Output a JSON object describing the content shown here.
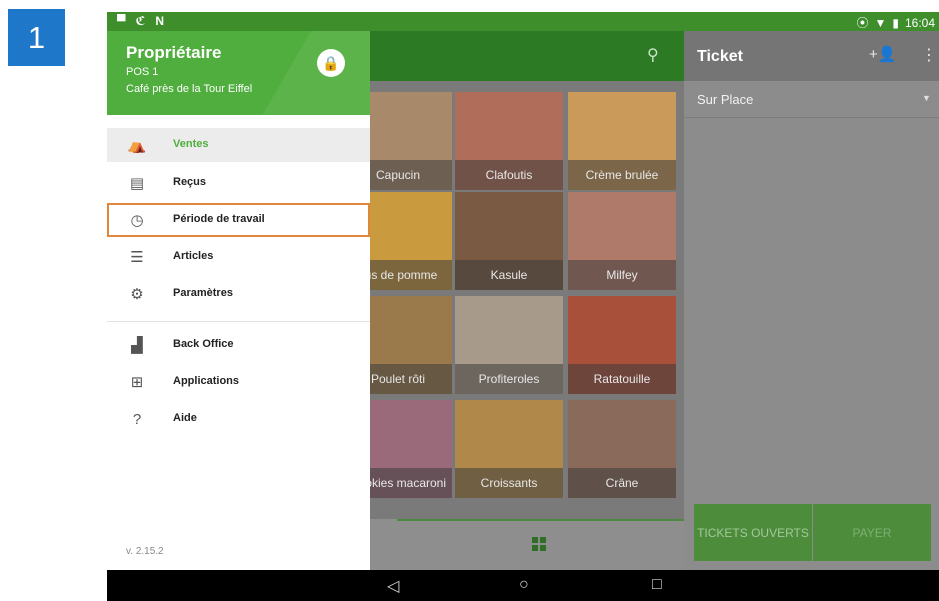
{
  "step_number": "1",
  "status_bar": {
    "left_icons": [
      "▀",
      "ℭ",
      "N"
    ],
    "time": "16:04"
  },
  "drawer": {
    "owner_name": "Propriétaire",
    "pos_name": "POS 1",
    "store_name": "Café près de la Tour Eiffel",
    "menu": [
      {
        "label": "Ventes",
        "icon": "basket-icon",
        "active": true
      },
      {
        "label": "Reçus",
        "icon": "receipt-icon"
      },
      {
        "label": "Période de travail",
        "icon": "clock-icon",
        "highlighted": true
      },
      {
        "label": "Articles",
        "icon": "list-icon"
      },
      {
        "label": "Paramètres",
        "icon": "gear-icon"
      },
      {
        "label": "Back Office",
        "icon": "bar-chart-icon"
      },
      {
        "label": "Applications",
        "icon": "apps-icon"
      },
      {
        "label": "Aide",
        "icon": "help-icon"
      }
    ],
    "version": "v. 2.15.2"
  },
  "products": [
    {
      "name": "Capucin",
      "color": "#a88a6a"
    },
    {
      "name": "Clafoutis",
      "color": "#b06e5a"
    },
    {
      "name": "Crème brulée",
      "color": "#c99a5a"
    },
    {
      "name": "Jus de pomme",
      "color": "#c99a3e"
    },
    {
      "name": "Kasule",
      "color": "#7a5a42"
    },
    {
      "name": "Milfey",
      "color": "#b07a6a"
    },
    {
      "name": "Poulet rôti",
      "color": "#9a7a4a"
    },
    {
      "name": "Profiteroles",
      "color": "#a89a8a"
    },
    {
      "name": "Ratatouille",
      "color": "#a8503a"
    },
    {
      "name": "Cookies macaroni",
      "color": "#9a6a7a"
    },
    {
      "name": "Croissants",
      "color": "#b0894a"
    },
    {
      "name": "Crâne",
      "color": "#8a6a5a"
    }
  ],
  "ticket": {
    "title": "Ticket",
    "dining_option": "Sur Place",
    "open_tickets_label": "TICKETS OUVERTS",
    "pay_label": "PAYER"
  },
  "colors": {
    "brand_green": "#4fae3d",
    "highlight": "#e0873e",
    "badge": "#1e77c9"
  }
}
